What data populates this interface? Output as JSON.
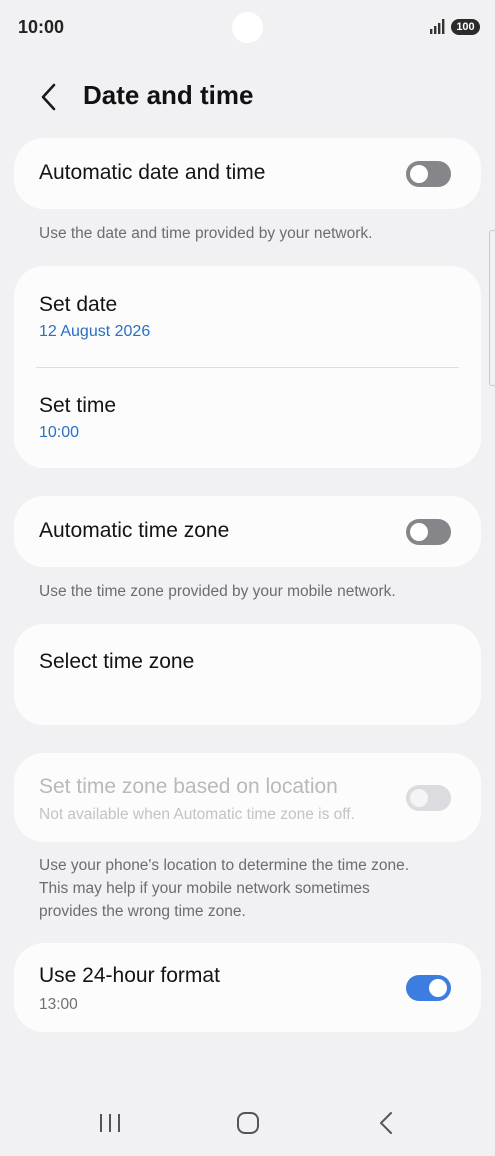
{
  "status_bar": {
    "time": "10:00",
    "battery": "100"
  },
  "header": {
    "title": "Date and time"
  },
  "auto_date_time": {
    "title": "Automatic date and time",
    "enabled": false,
    "description": "Use the date and time provided by your network."
  },
  "set_date": {
    "title": "Set date",
    "value": "12 August 2026"
  },
  "set_time": {
    "title": "Set time",
    "value": "10:00"
  },
  "auto_time_zone": {
    "title": "Automatic time zone",
    "enabled": false,
    "description": "Use the time zone provided by your mobile network."
  },
  "select_time_zone": {
    "title": "Select time zone"
  },
  "tz_location": {
    "title": "Set time zone based on location",
    "subtitle": "Not available when Automatic time zone is off.",
    "enabled": false,
    "description_lines": [
      "Use your phone's location to determine the time zone.",
      "This may help if your mobile network sometimes",
      "provides the wrong time zone."
    ]
  },
  "format_24h": {
    "title": "Use 24-hour format",
    "subtitle": "13:00",
    "enabled": true
  },
  "icons": {
    "back": "chevron-left-icon",
    "signal": "signal-icon",
    "nav_recents": "recent-apps-icon",
    "nav_home": "home-icon",
    "nav_back": "back-icon"
  },
  "colors": {
    "accent": "#3d7de0",
    "link_blue": "#2a6fc1",
    "background": "#f1f1f4",
    "card": "#fcfcfd"
  }
}
